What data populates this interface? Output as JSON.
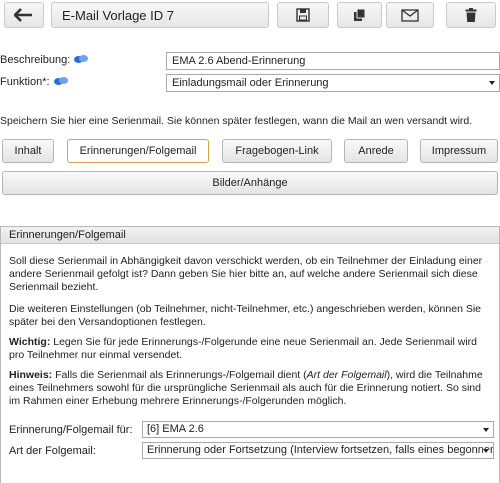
{
  "toolbar": {
    "title": "E-Mail Vorlage ID 7",
    "back_icon": "back-arrow-icon",
    "save_icon": "floppy-disk-icon",
    "copy_icon": "copy-icon",
    "mail_icon": "envelope-icon",
    "delete_icon": "trash-icon"
  },
  "form": {
    "beschreibung_label": "Beschreibung:",
    "beschreibung_value": "EMA 2.6 Abend-Erinnerung",
    "funktion_label": "Funktion*:",
    "funktion_value": "Einladungsmail oder Erinnerung"
  },
  "info_text": "Speichern Sie hier eine Serienmail. Sie können später festlegen, wann die Mail an wen versandt wird.",
  "tabs": {
    "inhalt": "Inhalt",
    "erinnerungen": "Erinnerungen/Folgemail",
    "fragebogen": "Fragebogen-Link",
    "anrede": "Anrede",
    "impressum": "Impressum",
    "bilder": "Bilder/Anhänge"
  },
  "panel": {
    "title": "Erinnerungen/Folgemail",
    "p1": "Soll diese Serienmail in Abhängigkeit davon verschickt werden, ob ein Teilnehmer der Einladung einer andere Serienmail gefolgt ist? Dann geben Sie hier bitte an, auf welche andere Serienmail sich diese Serienmail bezieht.",
    "p2": "Die weiteren Einstellungen (ob Teilnehmer, nicht-Teilnehmer, etc.) angeschrieben werden, können Sie später bei den Versandoptionen festlegen.",
    "p3_bold": "Wichtig:",
    "p3_rest": " Legen Sie für jede Erinnerungs-/Folgerunde eine neue Serienmail an. Jede Serienmail wird pro Teilnehmer nur einmal versendet.",
    "p4_bold": "Hinweis:",
    "p4_a": " Falls die Serienmail als Erinnerungs-/Folgemail dient (",
    "p4_italic": "Art der Folgemail",
    "p4_b": "), wird die Teilnahme eines Teilnehmers sowohl für die ursprüngliche Serienmail als auch für die Erinnerung notiert. So sind im Rahmen einer Erhebung mehrere Erinnerungs-/Folgerunden möglich.",
    "folgemail_label": "Erinnerung/Folgemail für:",
    "folgemail_value": "[6] EMA 2.6",
    "art_label": "Art der Folgemail:",
    "art_value": "Erinnerung oder Fortsetzung (Interview fortsetzen, falls eines begonnen)"
  },
  "colors": {
    "active_tab_border": "#e0a048",
    "info_icon": "#2b6fd6"
  }
}
